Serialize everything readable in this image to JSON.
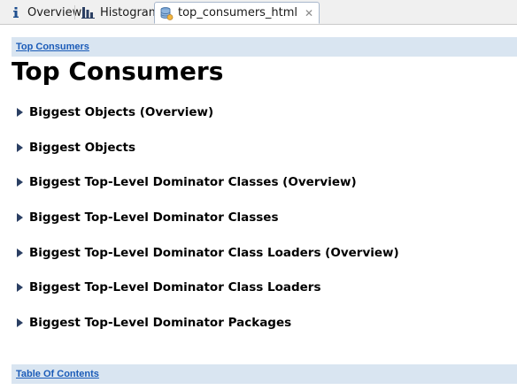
{
  "tabs": [
    {
      "label": "Overview",
      "icon": "info-icon",
      "active": false
    },
    {
      "label": "Histogram",
      "icon": "histogram-icon",
      "active": false
    },
    {
      "label": "top_consumers_html",
      "icon": "database-icon",
      "active": true,
      "close_glyph": "✕"
    }
  ],
  "nav_top": {
    "link": "Top Consumers"
  },
  "page_title": "Top Consumers",
  "sections": [
    {
      "label": "Biggest Objects (Overview)",
      "icon": "expand-arrow-icon"
    },
    {
      "label": "Biggest Objects",
      "icon": "expand-arrow-icon"
    },
    {
      "label": "Biggest Top-Level Dominator Classes (Overview)",
      "icon": "expand-arrow-icon"
    },
    {
      "label": "Biggest Top-Level Dominator Classes",
      "icon": "expand-arrow-icon"
    },
    {
      "label": "Biggest Top-Level Dominator Class Loaders (Overview)",
      "icon": "expand-arrow-icon"
    },
    {
      "label": "Biggest Top-Level Dominator Class Loaders",
      "icon": "expand-arrow-icon"
    },
    {
      "label": "Biggest Top-Level Dominator Packages",
      "icon": "expand-arrow-icon"
    }
  ],
  "nav_bottom": {
    "link": "Table Of Contents"
  },
  "colors": {
    "nav_bar_bg": "#d9e5f1",
    "link": "#1a5bb8",
    "tab_border": "#a9b8cc"
  }
}
